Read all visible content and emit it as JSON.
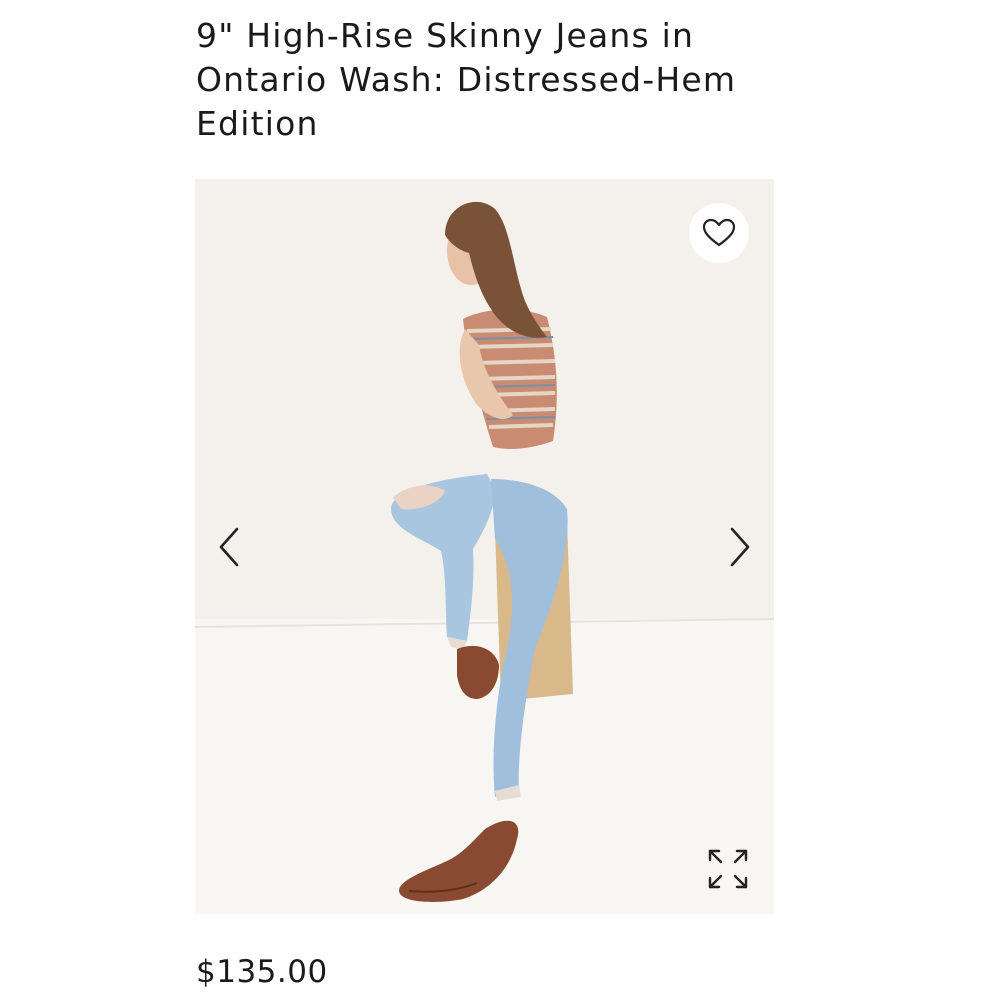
{
  "product": {
    "title": "9\" High-Rise Skinny Jeans in Ontario Wash: Distressed-Hem Edition",
    "price": "$135.00"
  },
  "gallery": {
    "favorite_icon": "heart-outline-icon",
    "prev_icon": "chevron-left-icon",
    "next_icon": "chevron-right-icon",
    "expand_icon": "expand-arrows-icon"
  },
  "colors": {
    "text": "#1a1a1a",
    "image_background": "#f4f1ec",
    "icon": "#222222"
  }
}
